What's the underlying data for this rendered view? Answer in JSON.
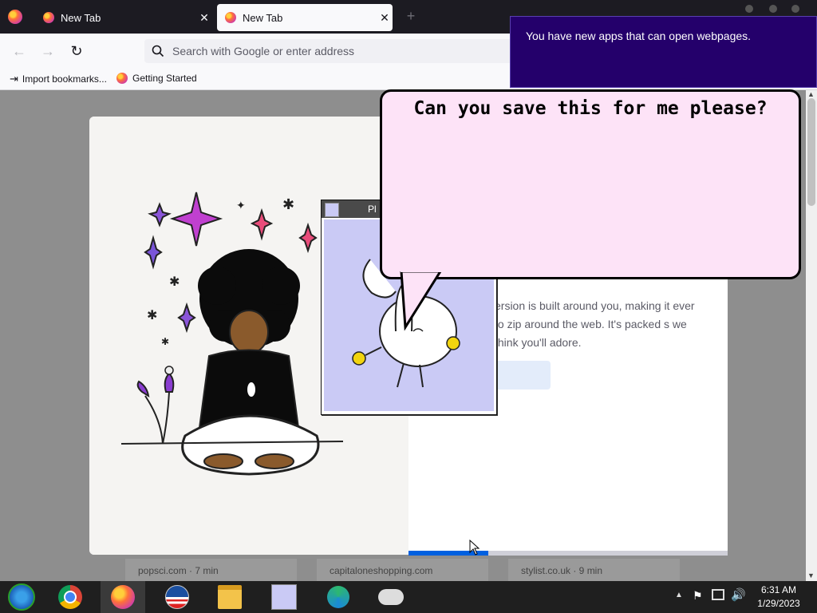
{
  "browser": {
    "tabs": [
      {
        "label": "New Tab",
        "active": false
      },
      {
        "label": "New Tab",
        "active": true
      }
    ],
    "new_tab_icon": "plus-icon",
    "url_placeholder": "Search with Google or enter address",
    "bookmarks": [
      {
        "label": "Import bookmarks...",
        "icon": "import-icon"
      },
      {
        "label": "Getting Started",
        "icon": "firefox-icon"
      }
    ]
  },
  "page": {
    "card_text": "ersion is built around you, making it ever to zip around the web. It's packed s we think you'll adore.",
    "stories": [
      {
        "source": "popsci.com · 7 min"
      },
      {
        "source": "capitaloneshopping.com"
      },
      {
        "source": "stylist.co.uk · 9 min"
      }
    ],
    "progress": 0.25
  },
  "buddy": {
    "title": "Pl"
  },
  "bubble": {
    "text": "Can you save this for me please?"
  },
  "toast": {
    "message": "You have new apps that can open webpages."
  },
  "taskbar": {
    "apps": [
      "windows-start-icon",
      "chrome-icon",
      "firefox-icon",
      "obama-logo-icon",
      "file-explorer-icon",
      "bunny-app-icon",
      "edge-icon",
      "gamepad-icon"
    ],
    "time": "6:31 AM",
    "date": "1/29/2023"
  },
  "colors": {
    "toast_bg": "#24006b",
    "bubble_bg": "#fde3f7",
    "accent": "#0060df"
  }
}
